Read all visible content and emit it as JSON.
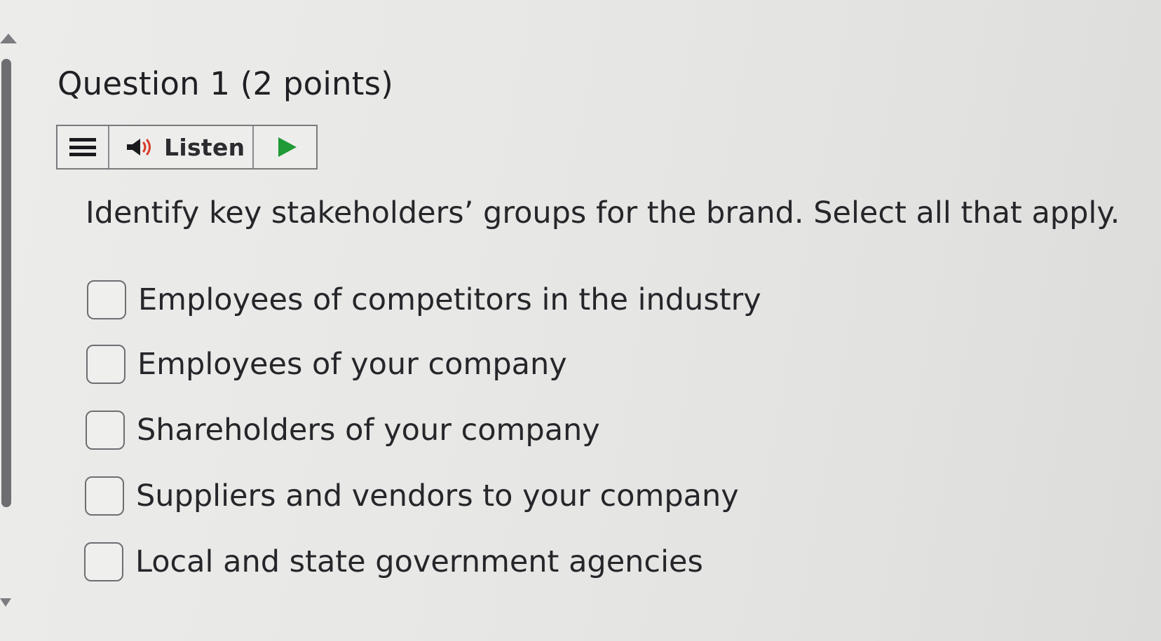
{
  "question": {
    "title": "Question 1",
    "points": "(2 points)",
    "prompt": "Identify key stakeholders’ groups for the brand. Select all that apply."
  },
  "listen_toolbar": {
    "menu_icon": "hamburger-menu-icon",
    "speaker_icon": "speaker-volume-icon",
    "listen_label": "Listen",
    "play_icon": "play-icon",
    "colors": {
      "speaker_wave": "#d83a2a",
      "play": "#1f9a36"
    }
  },
  "options": [
    {
      "label": "Employees of competitors in the industry",
      "checked": false
    },
    {
      "label": "Employees of your company",
      "checked": false
    },
    {
      "label": "Shareholders of your company",
      "checked": false
    },
    {
      "label": "Suppliers and vendors to your company",
      "checked": false
    },
    {
      "label": "Local and state government agencies",
      "checked": false
    }
  ]
}
